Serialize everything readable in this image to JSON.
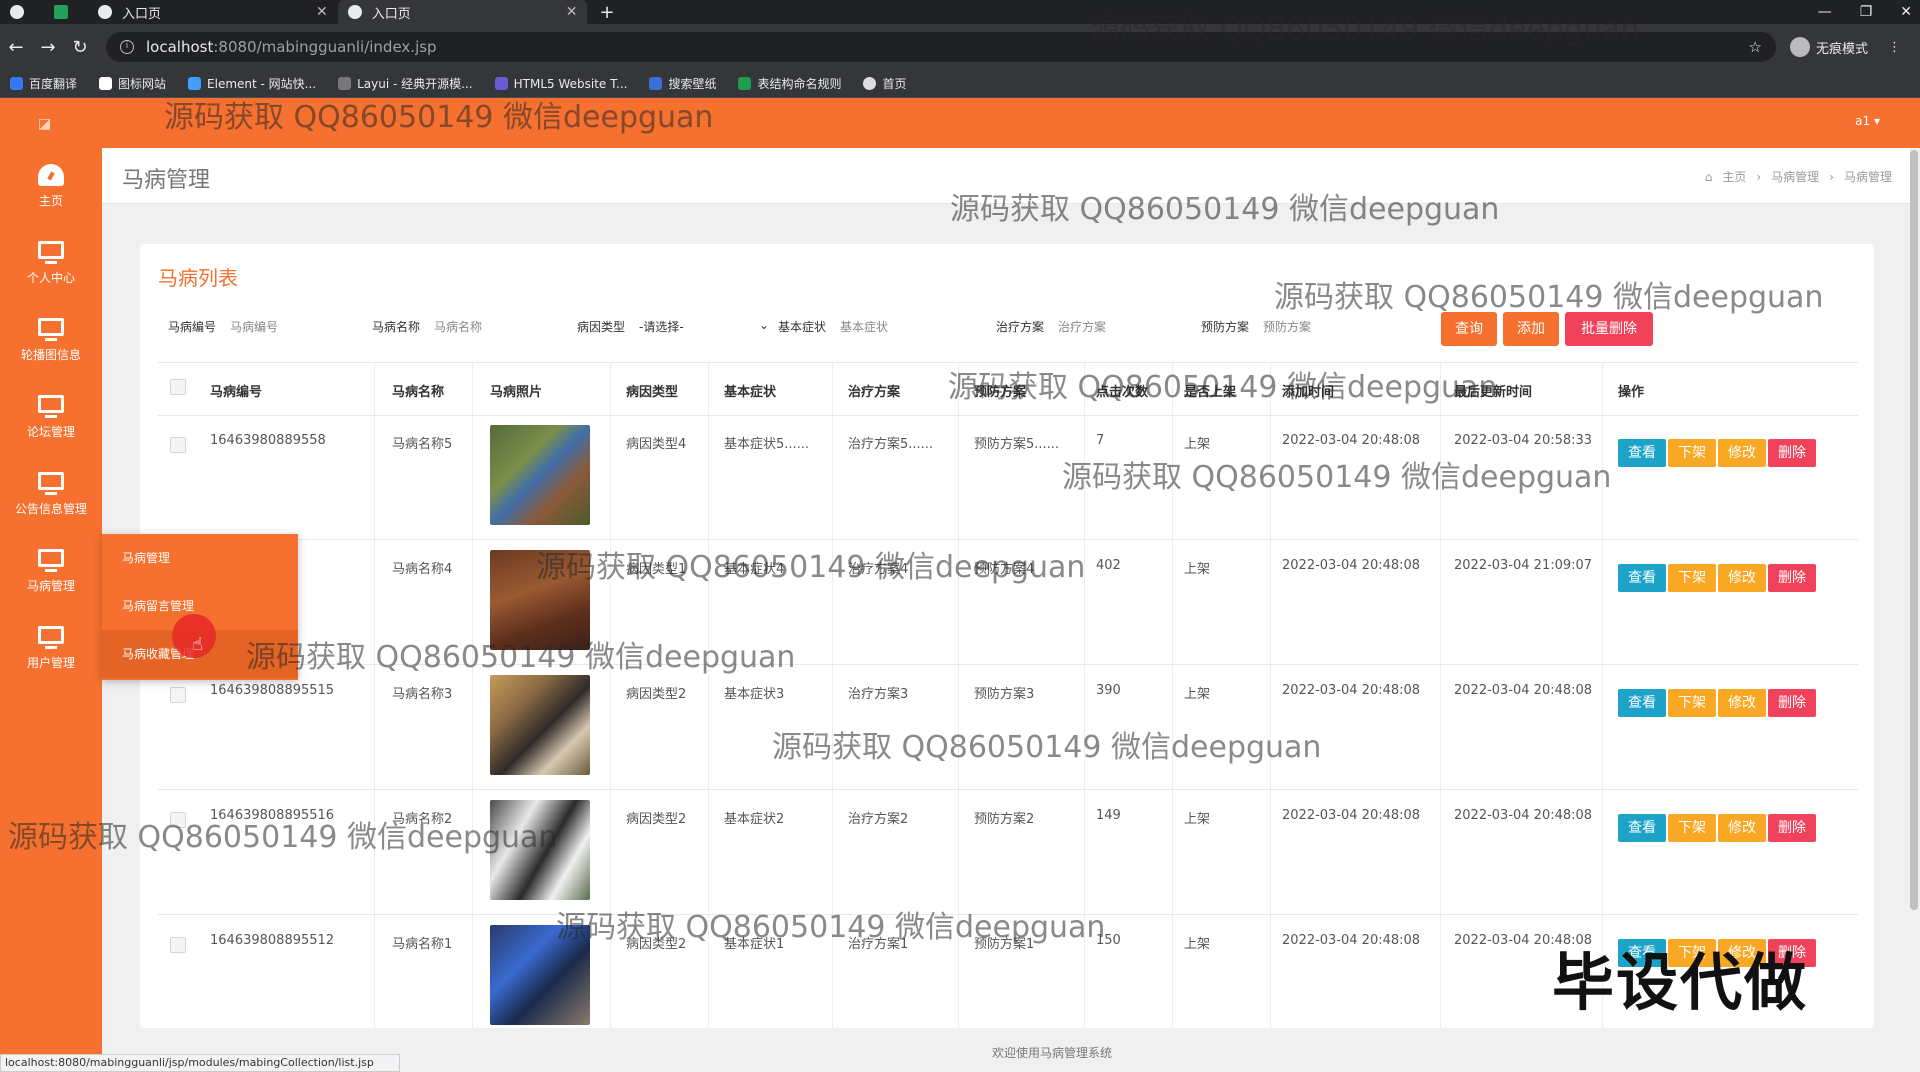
{
  "browser": {
    "tabs": [
      {
        "title": ""
      },
      {
        "title": "入口页"
      },
      {
        "title": "入口页"
      }
    ],
    "url_host": "localhost",
    "url_path": ":8080/mabingguanli/index.jsp",
    "profile_label": "无痕模式",
    "bookmarks": [
      "百度翻译",
      "图标网站",
      "Element - 网站快...",
      "Layui - 经典开源模...",
      "HTML5 Website T...",
      "搜索壁纸",
      "表结构命名规则",
      "首页"
    ]
  },
  "header": {
    "user": "a1 ▾"
  },
  "sidebar": {
    "items": [
      "主页",
      "个人中心",
      "轮播图信息",
      "论坛管理",
      "公告信息管理",
      "马病管理",
      "用户管理"
    ]
  },
  "submenu": {
    "items": [
      "马病管理",
      "马病留言管理",
      "马病收藏管理"
    ]
  },
  "page": {
    "title": "马病管理",
    "breadcrumb": {
      "home": "主页",
      "level1": "马病管理",
      "level2": "马病管理"
    },
    "panel_title": "马病列表"
  },
  "search": {
    "fields": [
      {
        "label": "马病编号",
        "placeholder": "马病编号"
      },
      {
        "label": "马病名称",
        "placeholder": "马病名称"
      },
      {
        "label": "病因类型",
        "placeholder": "-请选择-"
      },
      {
        "label": "基本症状",
        "placeholder": "基本症状"
      },
      {
        "label": "治疗方案",
        "placeholder": "治疗方案"
      },
      {
        "label": "预防方案",
        "placeholder": "预防方案"
      }
    ],
    "btn_query": "查询",
    "btn_add": "添加",
    "btn_batch_delete": "批量删除"
  },
  "table": {
    "headers": [
      "马病编号",
      "马病名称",
      "马病照片",
      "病因类型",
      "基本症状",
      "治疗方案",
      "预防方案",
      "点击次数",
      "是否上架",
      "添加时间",
      "最后更新时间",
      "操作"
    ],
    "actions": {
      "view": "查看",
      "off": "下架",
      "edit": "修改",
      "delete": "删除"
    },
    "rows": [
      {
        "id": "16463980889558",
        "name": "马病名称5",
        "type": "病因类型4",
        "symptom": "基本症状5......",
        "treat": "治疗方案5......",
        "prevent": "预防方案5......",
        "clicks": "7",
        "onshelf": "上架",
        "added": "2022-03-04 20:48:08",
        "updated": "2022-03-04 20:58:33"
      },
      {
        "id": "",
        "name": "马病名称4",
        "type": "病因类型1",
        "symptom": "基本症状4",
        "treat": "治疗方案4",
        "prevent": "预防方案4",
        "clicks": "402",
        "onshelf": "上架",
        "added": "2022-03-04 20:48:08",
        "updated": "2022-03-04 21:09:07"
      },
      {
        "id": "164639808895515",
        "name": "马病名称3",
        "type": "病因类型2",
        "symptom": "基本症状3",
        "treat": "治疗方案3",
        "prevent": "预防方案3",
        "clicks": "390",
        "onshelf": "上架",
        "added": "2022-03-04 20:48:08",
        "updated": "2022-03-04 20:48:08"
      },
      {
        "id": "164639808895516",
        "name": "马病名称2",
        "type": "病因类型2",
        "symptom": "基本症状2",
        "treat": "治疗方案2",
        "prevent": "预防方案2",
        "clicks": "149",
        "onshelf": "上架",
        "added": "2022-03-04 20:48:08",
        "updated": "2022-03-04 20:48:08"
      },
      {
        "id": "164639808895512",
        "name": "马病名称1",
        "type": "病因类型2",
        "symptom": "基本症状1",
        "treat": "治疗方案1",
        "prevent": "预防方案1",
        "clicks": "150",
        "onshelf": "上架",
        "added": "2022-03-04 20:48:08",
        "updated": "2022-03-04 20:48:08"
      }
    ]
  },
  "footer": "欢迎使用马病管理系统",
  "status_url": "localhost:8080/mabingguanli/jsp/modules/mabingCollection/list.jsp",
  "watermark": "源码获取 QQ86050149 微信deepguan",
  "stamp": "毕设代做",
  "colors": {
    "accent": "#f6702f",
    "view": "#1ea3c8",
    "off": "#f9a825",
    "edit": "#f9a825",
    "delete": "#f0425a",
    "add": "#f6702f",
    "batch": "#f0425a"
  }
}
